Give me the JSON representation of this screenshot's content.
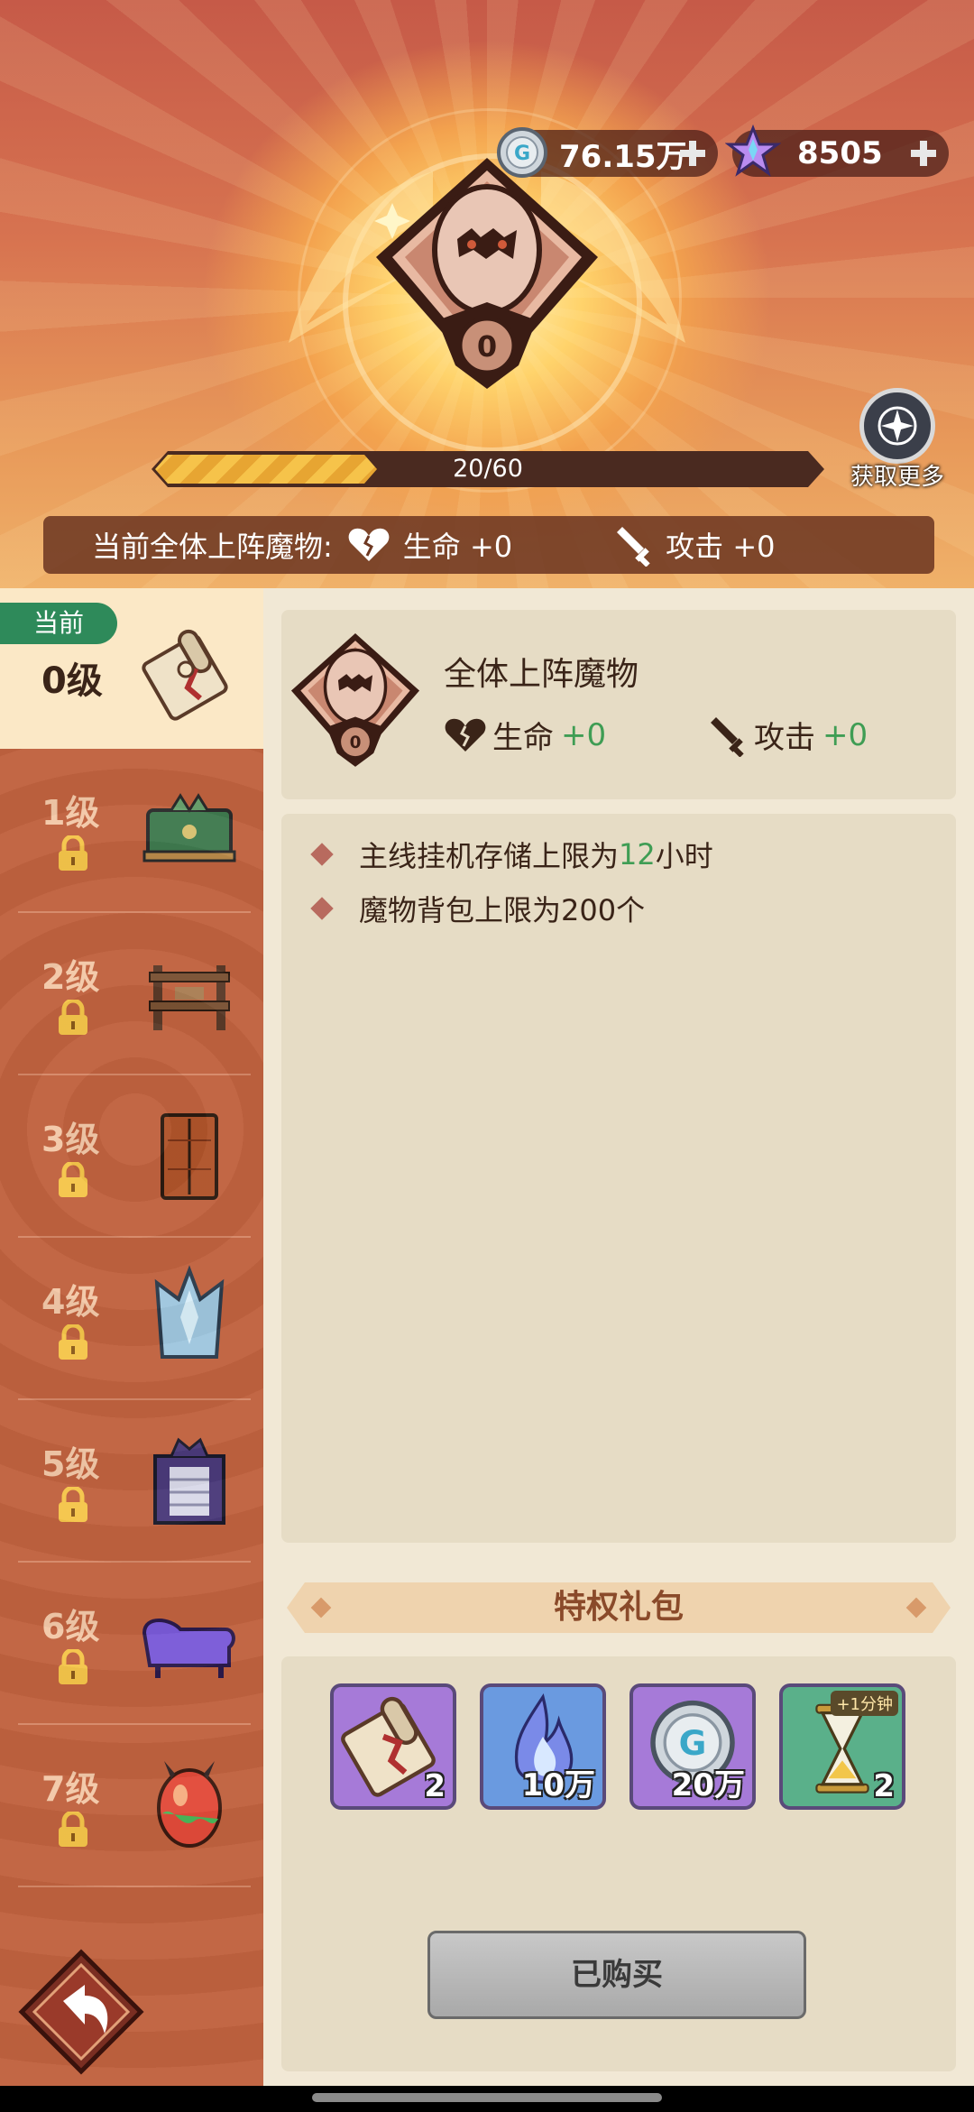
{
  "header": {
    "currency_coin": {
      "icon": "coin-icon",
      "value": "76.15万"
    },
    "currency_gem": {
      "icon": "gem-icon",
      "value": "8505"
    },
    "badge_level": "0",
    "progress": {
      "text": "20/60",
      "fraction": 0.333
    },
    "get_more_label": "获取更多",
    "stat_prefix": "当前全体上阵魔物:",
    "stat_hp": "生命 +0",
    "stat_atk": "攻击 +0"
  },
  "sidebar": {
    "current_tag": "当前",
    "current_level": "0级",
    "levels": [
      "1级",
      "2级",
      "3级",
      "4级",
      "5级",
      "6级",
      "7级"
    ]
  },
  "detail": {
    "title": "全体上阵魔物",
    "badge_level": "0",
    "hp_label": "生命",
    "hp_value": "+0",
    "atk_label": "攻击",
    "atk_value": "+0",
    "line1_prefix": "主线挂机存储上限为",
    "line1_value": "12",
    "line1_suffix": "小时",
    "line2": "魔物背包上限为200个"
  },
  "pack": {
    "title": "特权礼包",
    "rewards": [
      {
        "icon": "scroll-icon",
        "count": "2"
      },
      {
        "icon": "blue-flame-icon",
        "count": "10万"
      },
      {
        "icon": "coin-icon",
        "count": "20万"
      },
      {
        "icon": "hourglass-icon",
        "count": "2",
        "corner": "+1分钟"
      }
    ],
    "buy_label": "已购买"
  },
  "colors": {
    "accent_green": "#3f9d54",
    "sidebar_red": "#c0623f",
    "panel": "#e6dcc5"
  }
}
